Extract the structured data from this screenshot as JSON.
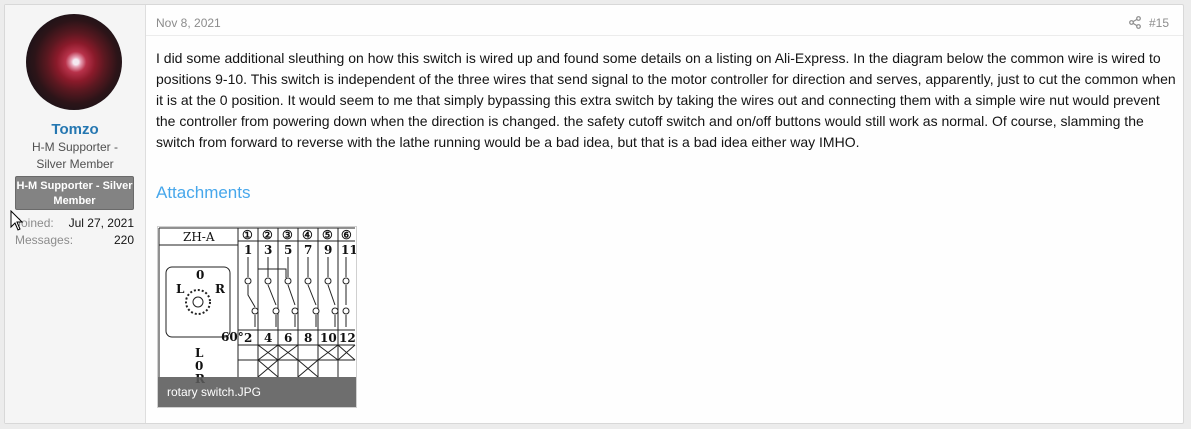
{
  "user": {
    "name": "Tomzo",
    "title": "H-M Supporter - Silver Member",
    "banner": "H-M Supporter - Silver Member",
    "joined_label": "Joined:",
    "joined_value": "Jul 27, 2021",
    "messages_label": "Messages:",
    "messages_value": "220",
    "avatar_icon": "avatar-nebula-image"
  },
  "post": {
    "date": "Nov 8, 2021",
    "number": "#15",
    "share_icon": "share-icon",
    "body": "I did some additional sleuthing on how this switch is wired up and found some details on a listing on Ali-Express. In the diagram below the common wire is wired to positions 9-10. This switch is independent of the three wires that send signal to the motor controller for direction and serves, apparently, just to cut the common when it is at the 0 position. It would seem to me that simply bypassing this extra switch by taking the wires out and connecting them with a simple wire nut would prevent the controller from powering down when the direction is changed. the safety cutoff switch and on/off buttons would still work as normal. Of course, slamming the switch from forward to reverse with the lathe running would be a bad idea, but that is a bad idea either way IMHO.",
    "attachments_heading": "Attachments"
  },
  "attachment": {
    "caption": "rotary switch.JPG",
    "diagram": {
      "model": "ZH-A",
      "positions": [
        "①",
        "②",
        "③",
        "④",
        "⑤",
        "⑥"
      ],
      "top_terminals": [
        "1",
        "3",
        "5",
        "7",
        "9",
        "11"
      ],
      "bottom_terminals": [
        "2",
        "4",
        "6",
        "8",
        "10",
        "12"
      ],
      "angle": "60°",
      "dial_labels": [
        "0",
        "L",
        "R"
      ],
      "row_labels": [
        "L",
        "0",
        "R"
      ]
    }
  },
  "colors": {
    "link": "#2577b1",
    "accent": "#47a7eb",
    "banner_bg": "#838383"
  }
}
